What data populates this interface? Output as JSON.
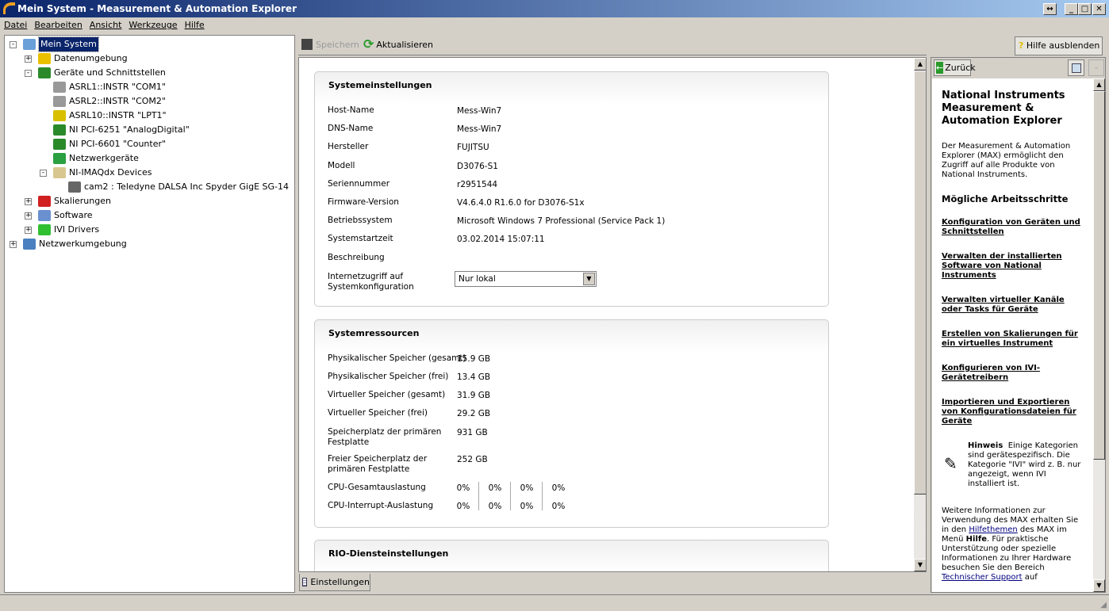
{
  "window": {
    "title": "Mein System - Measurement & Automation Explorer"
  },
  "menu": [
    "Datei",
    "Bearbeiten",
    "Ansicht",
    "Werkzeuge",
    "Hilfe"
  ],
  "tree": [
    {
      "label": "Mein System",
      "level": 0,
      "exp": "-",
      "icon": "computer-icon",
      "sel": true
    },
    {
      "label": "Datenumgebung",
      "level": 1,
      "exp": "+",
      "icon": "data-neighborhood-icon"
    },
    {
      "label": "Geräte und Schnittstellen",
      "level": 1,
      "exp": "-",
      "icon": "devices-icon"
    },
    {
      "label": "ASRL1::INSTR \"COM1\"",
      "level": 2,
      "icon": "serial-port-icon"
    },
    {
      "label": "ASRL2::INSTR \"COM2\"",
      "level": 2,
      "icon": "serial-port-icon"
    },
    {
      "label": "ASRL10::INSTR \"LPT1\"",
      "level": 2,
      "icon": "serial-port-warning-icon"
    },
    {
      "label": "NI PCI-6251 \"AnalogDigital\"",
      "level": 2,
      "icon": "pci-card-icon"
    },
    {
      "label": "NI PCI-6601 \"Counter\"",
      "level": 2,
      "icon": "pci-card-icon"
    },
    {
      "label": "Netzwerkgeräte",
      "level": 2,
      "icon": "network-device-icon"
    },
    {
      "label": "NI-IMAQdx Devices",
      "level": 2,
      "exp": "-",
      "icon": "camera-folder-icon"
    },
    {
      "label": "cam2 : Teledyne DALSA Inc Spyder GigE SG-14",
      "level": 3,
      "icon": "network-camera-icon"
    },
    {
      "label": "Skalierungen",
      "level": 1,
      "exp": "+",
      "icon": "scales-icon"
    },
    {
      "label": "Software",
      "level": 1,
      "exp": "+",
      "icon": "software-icon"
    },
    {
      "label": "IVI Drivers",
      "level": 1,
      "exp": "+",
      "icon": "ivi-icon"
    },
    {
      "label": "Netzwerkumgebung",
      "level": 0,
      "exp": "+",
      "icon": "network-icon"
    }
  ],
  "toolbar": {
    "save": "Speichern",
    "refresh": "Aktualisieren",
    "hide_help": "Hilfe ausblenden"
  },
  "settings": {
    "title": "Systemeinstellungen",
    "rows": [
      {
        "label": "Host-Name",
        "value": "Mess-Win7"
      },
      {
        "label": "DNS-Name",
        "value": "Mess-Win7"
      },
      {
        "label": "Hersteller",
        "value": "FUJITSU"
      },
      {
        "label": "Modell",
        "value": "D3076-S1"
      },
      {
        "label": "Seriennummer",
        "value": "r2951544"
      },
      {
        "label": "Firmware-Version",
        "value": "V4.6.4.0 R1.6.0 for D3076-S1x"
      },
      {
        "label": "Betriebssystem",
        "value": "Microsoft Windows 7 Professional  (Service Pack 1)"
      },
      {
        "label": "Systemstartzeit",
        "value": "03.02.2014 15:07:11"
      },
      {
        "label": "Beschreibung",
        "value": ""
      }
    ],
    "internet_label": "Internetzugriff auf Systemkonfiguration",
    "internet_value": "Nur lokal"
  },
  "resources": {
    "title": "Systemressourcen",
    "rows": [
      {
        "label": "Physikalischer Speicher (gesamt)",
        "value": "15.9 GB"
      },
      {
        "label": "Physikalischer Speicher (frei)",
        "value": "13.4 GB"
      },
      {
        "label": "Virtueller Speicher (gesamt)",
        "value": "31.9 GB"
      },
      {
        "label": "Virtueller Speicher (frei)",
        "value": "29.2 GB"
      },
      {
        "label": "Speicherplatz der primären Festplatte",
        "value": "931 GB"
      },
      {
        "label": "Freier Speicherplatz der primären Festplatte",
        "value": "252 GB"
      }
    ],
    "cpu_total_label": "CPU-Gesamtauslastung",
    "cpu_total": [
      "0%",
      "0%",
      "0%",
      "0%"
    ],
    "cpu_int_label": "CPU-Interrupt-Auslastung",
    "cpu_int": [
      "0%",
      "0%",
      "0%",
      "0%"
    ]
  },
  "rio": {
    "title": "RIO-Diensteinstellungen"
  },
  "tab": "Einstellungen",
  "help": {
    "back": "Zurück",
    "title": "National Instruments Measurement & Automation Explorer",
    "intro": "Der Measurement & Automation Explorer (MAX) ermöglicht den Zugriff auf alle Produkte von National Instruments.",
    "steps_title": "Mögliche Arbeitsschritte",
    "links": [
      "Konfiguration von Geräten und Schnittstellen",
      "Verwalten der installierten Software von National Instruments",
      "Verwalten virtueller Kanäle oder Tasks für Geräte",
      "Erstellen von Skalierungen für ein virtuelles Instrument",
      "Konfigurieren von IVI-Gerätetreibern",
      "Importieren und Exportieren von Konfigurationsdateien für Geräte"
    ],
    "note_bold": "Hinweis",
    "note": "Einige Kategorien sind gerätespezifisch. Die Kategorie \"IVI\" wird z. B. nur angezeigt, wenn IVI installiert ist.",
    "more1": "Weitere Informationen zur Verwendung des MAX erhalten Sie in den ",
    "more_link": "Hilfethemen",
    "more2": " des MAX im Menü ",
    "more_bold": "Hilfe",
    "more3": ". Für praktische Unterstützung oder spezielle Informationen zu Ihrer Hardware besuchen Sie den Bereich ",
    "more_link2": "Technischer Support",
    "more4": " auf"
  }
}
